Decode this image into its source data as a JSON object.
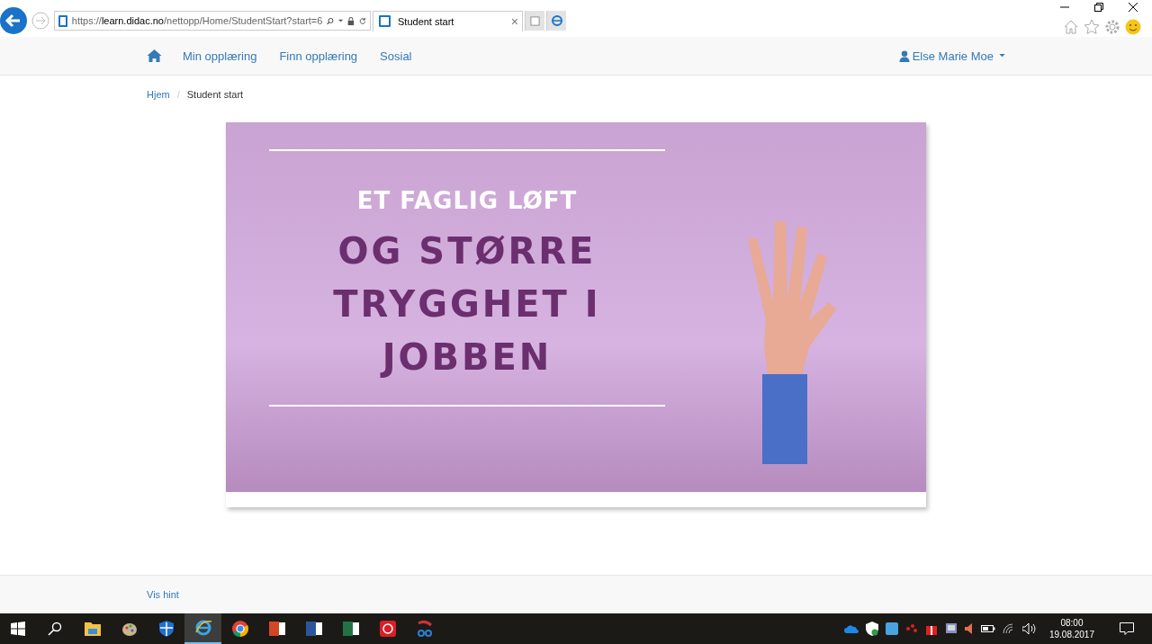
{
  "browser": {
    "url_scheme": "https://",
    "url_host": "learn.didac.no",
    "url_path": "/nettopp/Home/StudentStart?start=6",
    "tab_title": "Student start",
    "tab_close": "×"
  },
  "nav": {
    "items": [
      "Min opplæring",
      "Finn opplæring",
      "Sosial"
    ],
    "user": "Else Marie Moe"
  },
  "breadcrumb": {
    "link": "Hjem",
    "separator": "/",
    "current": "Student start"
  },
  "banner": {
    "kicker": "ET FAGLIG LØFT",
    "headline": [
      "OG STØRRE",
      "TRYGGHET I",
      "JOBBEN"
    ]
  },
  "footer": {
    "link": "Vis hint"
  },
  "taskbar": {
    "apps": [
      {
        "kind": "files",
        "selected": false
      },
      {
        "kind": "paint",
        "selected": false
      },
      {
        "kind": "shield",
        "selected": false
      },
      {
        "kind": "ie",
        "selected": true
      },
      {
        "kind": "chrome",
        "selected": false
      },
      {
        "kind": "powerpoint",
        "selected": false
      },
      {
        "kind": "word",
        "selected": false
      },
      {
        "kind": "excel",
        "selected": false
      },
      {
        "kind": "creative",
        "selected": false
      },
      {
        "kind": "snip",
        "selected": false
      }
    ],
    "time": "08:00",
    "date": "19.08.2017"
  }
}
